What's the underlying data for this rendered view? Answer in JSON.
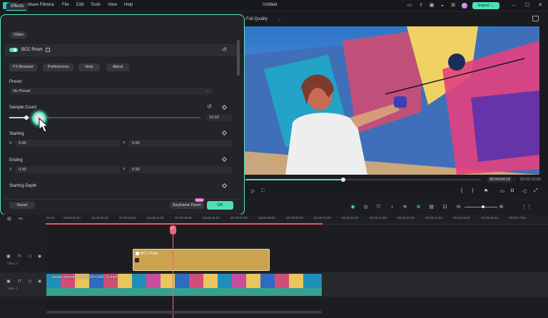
{
  "app": {
    "name": "Wondershare Filmora",
    "document_title": "Untitled",
    "menu": [
      "File",
      "Edit",
      "Tools",
      "View",
      "Help"
    ],
    "export_label": "Export"
  },
  "player": {
    "quality": "Full Quality",
    "current_time": "00:00:04:15",
    "separator": "/",
    "total_time": "00:00:10:00",
    "progress_fraction": 0.41
  },
  "effects_panel": {
    "tab": "Effects",
    "video_chip": "Video",
    "effect_name": "BCC Prism",
    "buttons": [
      "FX Browser",
      "Preferences",
      "Help",
      "About"
    ],
    "preset_label": "Preset",
    "preset_value": "No Preset",
    "sample_count_label": "Sample Count",
    "sample_count_value": "10.50",
    "starting_label": "Starting",
    "starting_x": "0.50",
    "starting_y": "0.50",
    "ending_label": "Ending",
    "ending_x": "0.50",
    "ending_y": "0.50",
    "starting_depth_label": "Starting Depth",
    "x_label": "X",
    "y_label": "Y",
    "reset_label": "Reset",
    "keyframe_label": "Keyframe Panel",
    "new_badge": "NEW",
    "ok_label": "OK"
  },
  "timeline": {
    "ruler_ticks": [
      "00:00",
      "00:00:01:00",
      "00:00:02:00",
      "00:00:03:00",
      "00:00:04:00",
      "00:00:05:00",
      "00:00:06:00",
      "00:00:07:00",
      "00:00:08:00",
      "00:00:09:00",
      "00:00:10:00",
      "00:00:11:00",
      "00:00:12:00",
      "00:00:13:00",
      "00:00:14:00",
      "00:00:15:00",
      "00:00:16:00",
      "00:00:17:00"
    ],
    "tracks": [
      {
        "name": "Video 3"
      },
      {
        "name": "Video 2"
      }
    ],
    "effect_clip_label": "BCC Prism",
    "video_clip_label": "people-woman-te-tfn-1920×1080 (1).mp4"
  },
  "colors": {
    "accent": "#4fe0b8",
    "playhead": "#f0637a",
    "effect_clip": "#c9a34e"
  }
}
